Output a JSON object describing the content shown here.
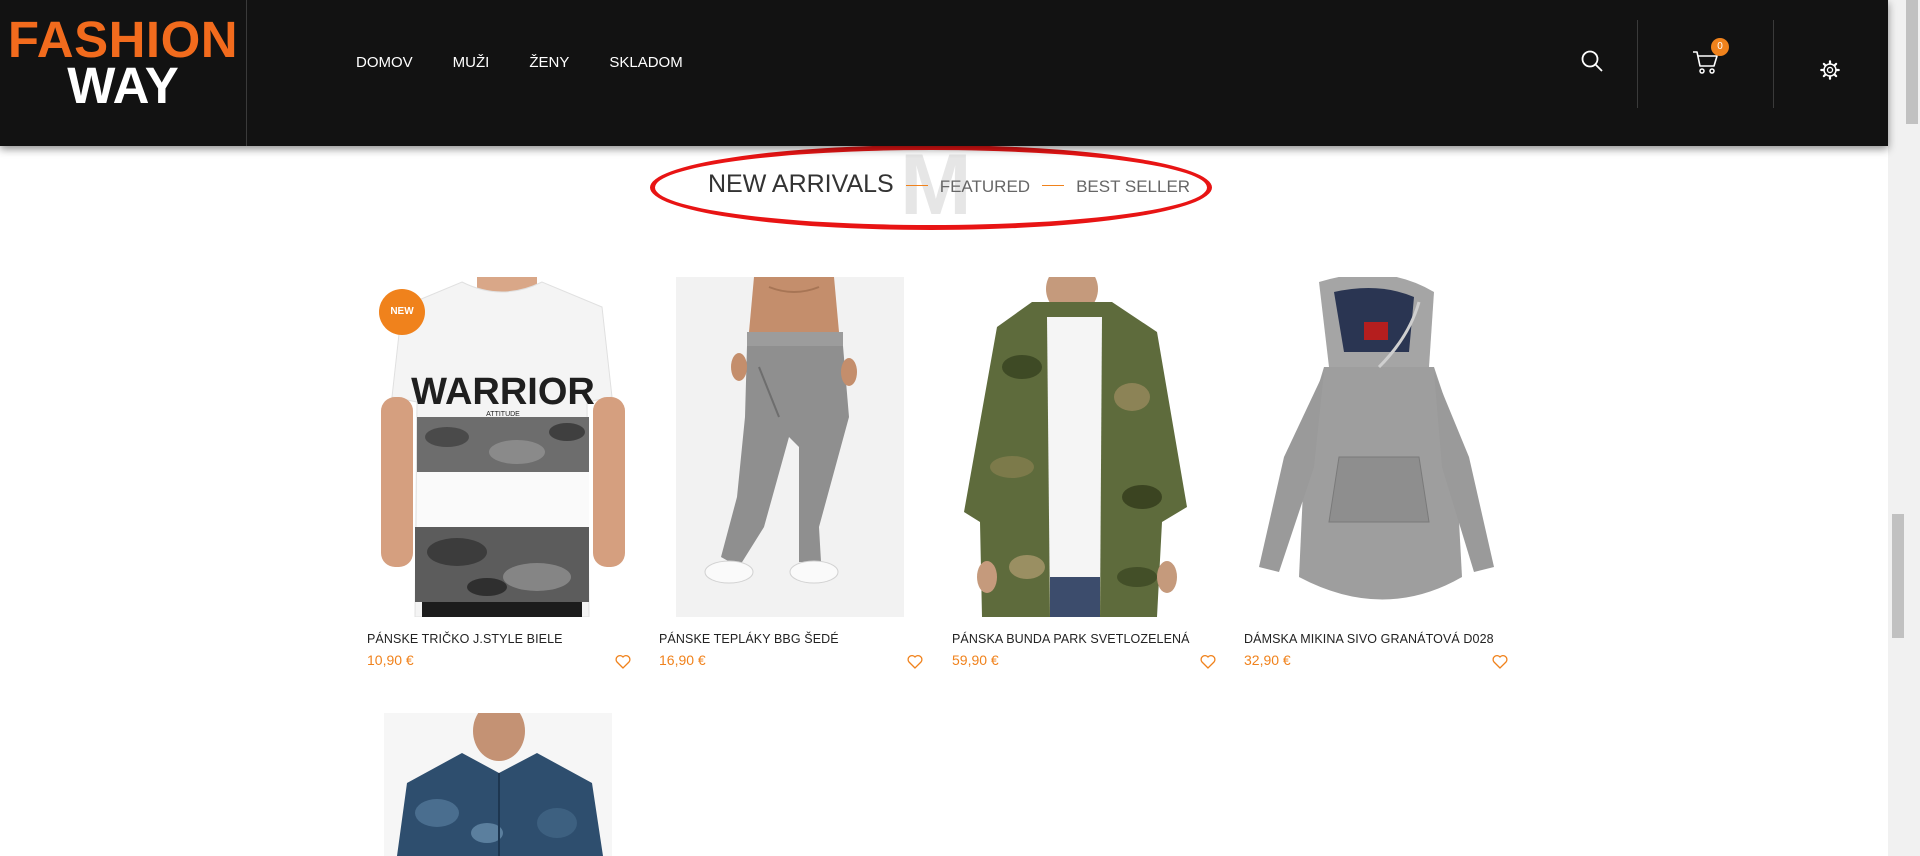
{
  "logo": {
    "line1": "FASHION",
    "line2": "WAY"
  },
  "nav": {
    "items": [
      "DOMOV",
      "MUŽI",
      "ŽENY",
      "SKLADOM"
    ]
  },
  "header": {
    "cart_count": "0"
  },
  "tabs": {
    "active": "NEW ARRIVALS",
    "featured": "FEATURED",
    "best_seller": "BEST SELLER",
    "bg_letter": "M"
  },
  "products": [
    {
      "name": "PÁNSKE TRIČKO J.STYLE BIELE",
      "price": "10,90 €",
      "badge": "NEW",
      "print_text": "WARRIOR",
      "print_sub": "ATTITUDE"
    },
    {
      "name": "PÁNSKE TEPLÁKY BBG ŠEDÉ",
      "price": "16,90 €"
    },
    {
      "name": "PÁNSKA BUNDA PARK SVETLOZELENÁ",
      "price": "59,90 €"
    },
    {
      "name": "DÁMSKA MIKINA SIVO GRANÁTOVÁ D028",
      "price": "32,90 €"
    }
  ],
  "colors": {
    "accent": "#f0821c",
    "header_bg": "#121212",
    "logo_orange": "#f26b1d",
    "annotation_red": "#e81414"
  }
}
